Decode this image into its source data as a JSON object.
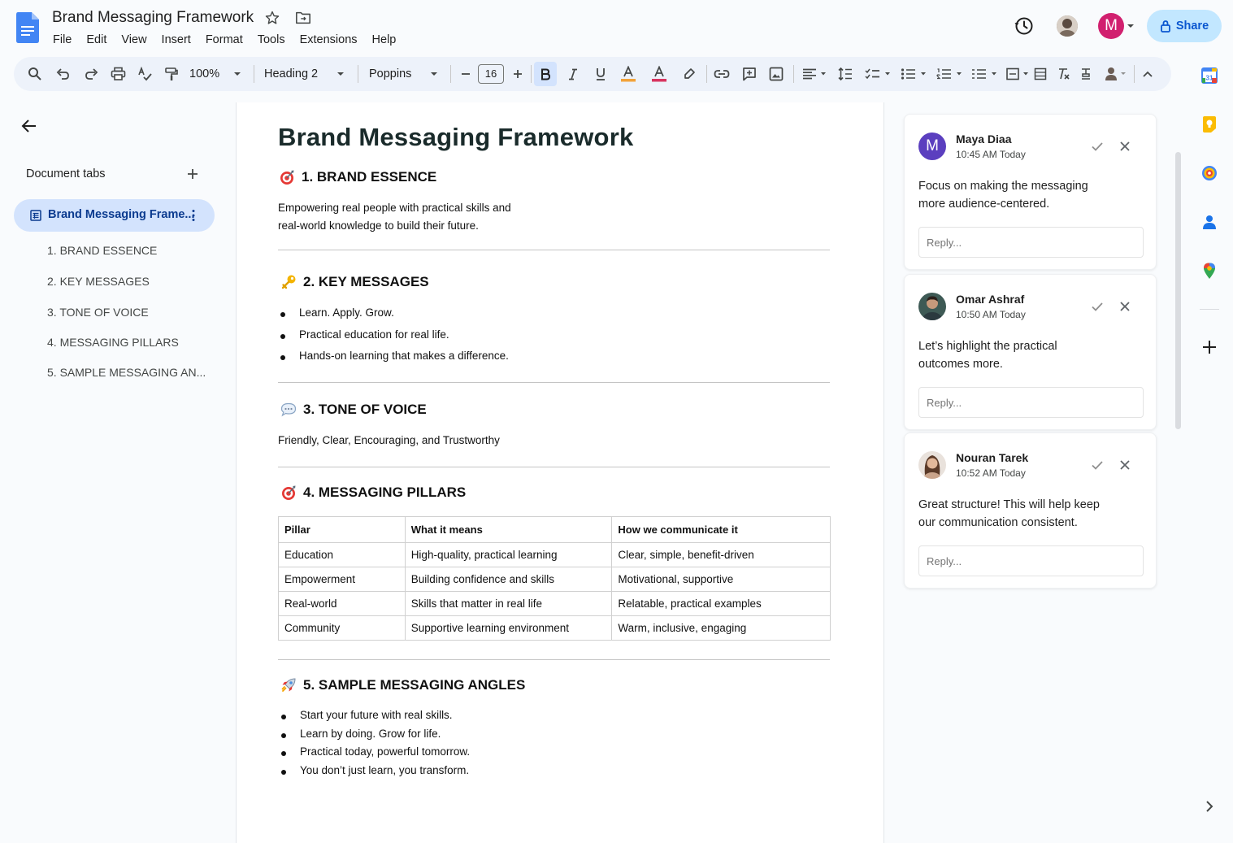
{
  "app": {
    "doc_title": "Brand Messaging Framework",
    "menus": [
      "File",
      "Edit",
      "View",
      "Insert",
      "Format",
      "Tools",
      "Extensions",
      "Help"
    ],
    "account_initial": "M",
    "share_label": "Share"
  },
  "toolbar": {
    "zoom": "100%",
    "style": "Heading 2",
    "font": "Poppins",
    "font_size": "16"
  },
  "sidebar": {
    "tabs_heading": "Document tabs",
    "active_tab": "Brand Messaging Frame...",
    "outline": [
      "1. BRAND ESSENCE",
      "2. KEY MESSAGES",
      "3. TONE OF VOICE",
      "4. MESSAGING PILLARS",
      "5. SAMPLE MESSAGING AN..."
    ]
  },
  "document": {
    "title": "Brand Messaging Framework",
    "s1": {
      "title": "1. BRAND ESSENCE",
      "lines": [
        "Empowering real people with practical skills and",
        "real-world knowledge to build their future."
      ]
    },
    "s2": {
      "title": "2. KEY MESSAGES",
      "bullets": [
        "Learn. Apply. Grow.",
        "Practical education for real life.",
        "Hands-on learning that makes a difference."
      ]
    },
    "s3": {
      "title": "3. TONE OF VOICE",
      "text": "Friendly, Clear, Encouraging, and Trustworthy"
    },
    "s4": {
      "title": "4. MESSAGING PILLARS",
      "headers": [
        "Pillar",
        "What it means",
        "How we communicate it"
      ],
      "rows": [
        [
          "Education",
          "High-quality, practical learning",
          "Clear, simple, benefit-driven"
        ],
        [
          "Empowerment",
          "Building confidence and skills",
          "Motivational, supportive"
        ],
        [
          "Real-world",
          "Skills that matter in real life",
          "Relatable, practical examples"
        ],
        [
          "Community",
          "Supportive learning environment",
          "Warm, inclusive, engaging"
        ]
      ]
    },
    "s5": {
      "title": "5. SAMPLE MESSAGING ANGLES",
      "bullets": [
        "Start your future with real skills.",
        "Learn by doing. Grow for life.",
        "Practical today, powerful tomorrow.",
        "You don’t just learn, you transform."
      ]
    }
  },
  "comments": [
    {
      "author": "Maya Diaa",
      "initial": "M",
      "time": "10:45 AM Today",
      "lines": [
        "Focus on making the messaging",
        "more audience-centered."
      ],
      "reply_placeholder": "Reply...",
      "avatar_color": "#5b3fbf"
    },
    {
      "author": "Omar Ashraf",
      "time": "10:50 AM Today",
      "lines": [
        "Let’s highlight the practical",
        "outcomes more."
      ],
      "reply_placeholder": "Reply..."
    },
    {
      "author": "Nouran Tarek",
      "time": "10:52 AM Today",
      "lines": [
        "Great structure! This will help keep",
        "our communication consistent."
      ],
      "reply_placeholder": "Reply..."
    }
  ],
  "colors": {
    "accent": "#0b57d0",
    "share_bg": "#c2e7ff",
    "toolbar_bg": "#edf2fa",
    "active_tab_bg": "#d3e3fd",
    "account_avatar": "#d1206f"
  }
}
